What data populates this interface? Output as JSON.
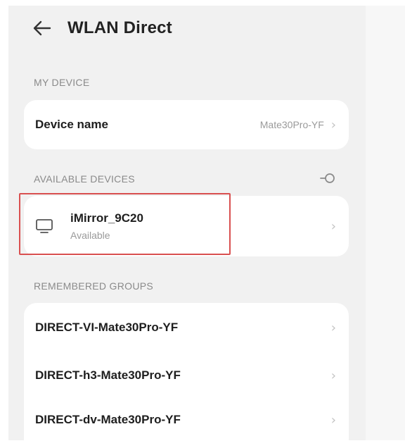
{
  "header": {
    "title": "WLAN Direct"
  },
  "my_device": {
    "section_label": "MY DEVICE",
    "device_name_label": "Device name",
    "device_name_value": "Mate30Pro-YF"
  },
  "available": {
    "section_label": "AVAILABLE DEVICES",
    "devices": [
      {
        "name": "iMirror_9C20",
        "status": "Available",
        "icon": "tv-icon"
      }
    ]
  },
  "remembered": {
    "section_label": "REMEMBERED GROUPS",
    "groups": [
      {
        "name": "DIRECT-VI-Mate30Pro-YF"
      },
      {
        "name": "DIRECT-h3-Mate30Pro-YF"
      },
      {
        "name": "DIRECT-dv-Mate30Pro-YF"
      }
    ]
  },
  "colors": {
    "background": "#f1f1f1",
    "card": "#ffffff",
    "highlight": "#d95050"
  }
}
